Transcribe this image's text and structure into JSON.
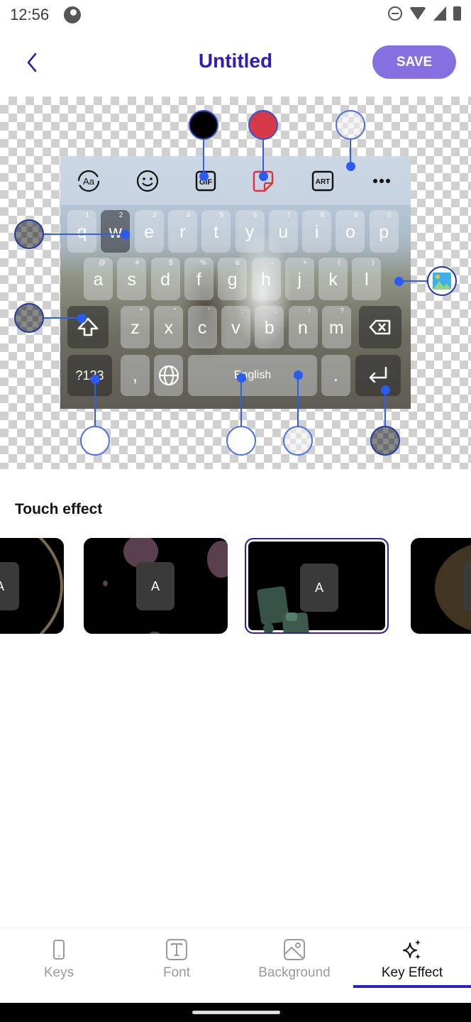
{
  "status_bar": {
    "time": "12:56",
    "icons": [
      "app-notification-icon",
      "do-not-disturb-icon",
      "wifi-icon",
      "signal-no-data-icon",
      "battery-icon"
    ]
  },
  "header": {
    "back_icon": "chevron-left-icon",
    "title": "Untitled",
    "save_label": "SAVE"
  },
  "colors": {
    "accent": "#2f1cb2",
    "save_button": "#8470e0",
    "picker_line": "#2e5ef0",
    "tab_indicator": "#2d22c8"
  },
  "keyboard": {
    "toolbar_icons": [
      "font-switch-icon",
      "emoji-icon",
      "gif-icon",
      "sticker-icon",
      "art-icon",
      "more-icon"
    ],
    "toolbar_labels": {
      "font": "Aa",
      "gif": "GIF",
      "art": "ART"
    },
    "rows": [
      [
        {
          "k": "q",
          "s": "1"
        },
        {
          "k": "w",
          "s": "2"
        },
        {
          "k": "e",
          "s": "3"
        },
        {
          "k": "r",
          "s": "4"
        },
        {
          "k": "t",
          "s": "5"
        },
        {
          "k": "y",
          "s": "6"
        },
        {
          "k": "u",
          "s": "7"
        },
        {
          "k": "i",
          "s": "8"
        },
        {
          "k": "o",
          "s": "9"
        },
        {
          "k": "p",
          "s": "0"
        }
      ],
      [
        {
          "k": "a",
          "s": "@"
        },
        {
          "k": "s",
          "s": "#"
        },
        {
          "k": "d",
          "s": "$"
        },
        {
          "k": "f",
          "s": "%"
        },
        {
          "k": "g",
          "s": "&"
        },
        {
          "k": "h",
          "s": "-"
        },
        {
          "k": "j",
          "s": "+"
        },
        {
          "k": "k",
          "s": "("
        },
        {
          "k": "l",
          "s": ")"
        }
      ],
      [
        {
          "k": "z",
          "s": "*"
        },
        {
          "k": "x",
          "s": "\""
        },
        {
          "k": "c",
          "s": "'"
        },
        {
          "k": "v",
          "s": ":"
        },
        {
          "k": "b",
          "s": ";"
        },
        {
          "k": "n",
          "s": "!"
        },
        {
          "k": "m",
          "s": "?"
        }
      ]
    ],
    "symbols_key": "?123",
    "comma_key": ",",
    "space_label": "English",
    "period_key": ".",
    "special_icons": [
      "shift-icon",
      "backspace-icon",
      "globe-icon",
      "enter-icon"
    ]
  },
  "color_pickers": [
    {
      "name": "gif-icon-color",
      "color": "#000000"
    },
    {
      "name": "sticker-icon-color",
      "color": "#d63a48"
    },
    {
      "name": "toolbar-background-color",
      "color": "transparent-light"
    },
    {
      "name": "key-pressed-color",
      "color": "transparent-dark"
    },
    {
      "name": "function-key-color",
      "color": "transparent-dark"
    },
    {
      "name": "background-image",
      "color": "image"
    },
    {
      "name": "function-key-text-color",
      "color": "#ffffff"
    },
    {
      "name": "space-text-color",
      "color": "#ffffff"
    },
    {
      "name": "space-key-color",
      "color": "transparent-light"
    },
    {
      "name": "enter-key-color",
      "color": "transparent-dark"
    }
  ],
  "touch_effect": {
    "title": "Touch effect",
    "cards": [
      {
        "label": "A",
        "effect": "ripple-ring",
        "selected": false
      },
      {
        "label": "A",
        "effect": "bubbles",
        "selected": false
      },
      {
        "label": "A",
        "effect": "squares",
        "selected": true
      },
      {
        "label": "A",
        "effect": "glow-circle",
        "selected": false
      }
    ]
  },
  "bottom_nav": {
    "items": [
      {
        "label": "Keys",
        "icon": "phone-icon",
        "active": false
      },
      {
        "label": "Font",
        "icon": "text-icon",
        "active": false
      },
      {
        "label": "Background",
        "icon": "image-icon",
        "active": false
      },
      {
        "label": "Key Effect",
        "icon": "sparkle-icon",
        "active": true
      }
    ]
  }
}
